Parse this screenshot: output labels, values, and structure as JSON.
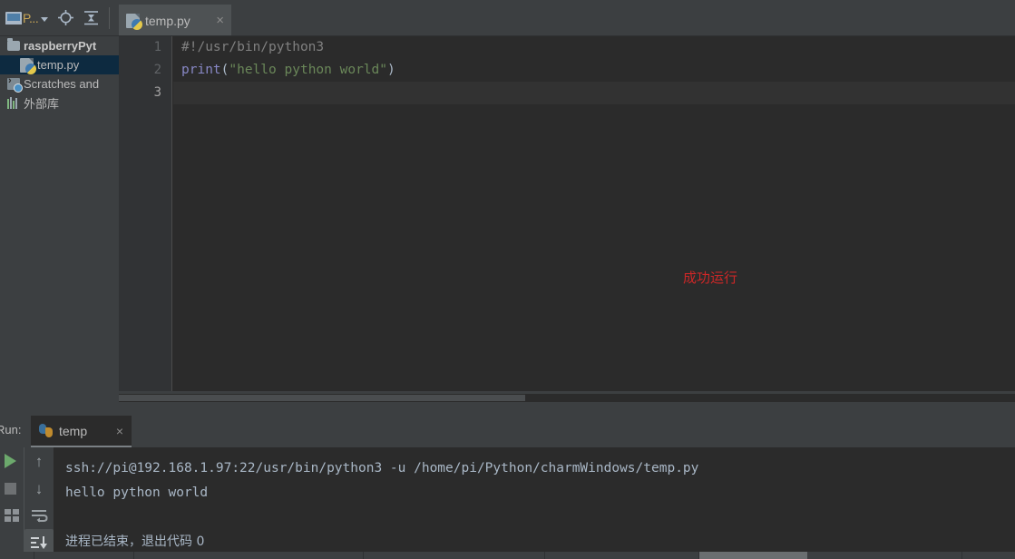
{
  "toolbar": {
    "project_button_label": "P...",
    "project_icon": "project-window-icon",
    "locate_icon": "target-locate-icon",
    "collapse_icon": "collapse-all-icon"
  },
  "editor_tabs": [
    {
      "label": "temp.py",
      "icon": "python-file-icon",
      "close": "×",
      "active": true
    }
  ],
  "project_tree": {
    "items": [
      {
        "label": "raspberryPyt",
        "icon": "folder-icon",
        "bold": true,
        "selected": false,
        "indent": false
      },
      {
        "label": "temp.py",
        "icon": "python-file-icon",
        "bold": false,
        "selected": true,
        "indent": true
      },
      {
        "label": "Scratches and",
        "icon": "scratches-icon",
        "bold": false,
        "selected": false,
        "indent": false
      },
      {
        "label": "外部库",
        "icon": "external-libraries-icon",
        "bold": false,
        "selected": false,
        "indent": false
      }
    ]
  },
  "editor": {
    "line_numbers": [
      "1",
      "2",
      "3"
    ],
    "current_line": 3,
    "lines": [
      {
        "tokens": [
          {
            "text": "#!/usr/bin/python3",
            "type": "comment"
          }
        ]
      },
      {
        "tokens": [
          {
            "text": "print",
            "type": "fn"
          },
          {
            "text": "(",
            "type": "punct"
          },
          {
            "text": "\"hello python world\"",
            "type": "str"
          },
          {
            "text": ")",
            "type": "punct"
          }
        ]
      },
      {
        "tokens": [
          {
            "text": "",
            "type": "punct"
          }
        ]
      }
    ],
    "annotation": {
      "text": "成功运行",
      "color": "#cc2727"
    }
  },
  "run_panel": {
    "label": "Run:",
    "tabs": [
      {
        "label": "temp",
        "icon": "python-logo-icon",
        "close": "×",
        "active": true
      }
    ],
    "side_buttons": [
      {
        "name": "rerun-button",
        "icon": "run-triangle-icon"
      },
      {
        "name": "stop-button",
        "icon": "stop-square-icon"
      },
      {
        "name": "print-button",
        "icon": "print-icon"
      }
    ],
    "side_buttons_2": [
      {
        "name": "up-stack-button",
        "icon": "arrow-up-icon",
        "glyph": "↑"
      },
      {
        "name": "down-stack-button",
        "icon": "arrow-down-icon",
        "glyph": "↓"
      },
      {
        "name": "soft-wrap-button",
        "icon": "soft-wrap-icon",
        "glyph": "↩"
      },
      {
        "name": "scroll-to-end-button",
        "icon": "scroll-to-end-icon",
        "glyph": "⤓"
      }
    ],
    "console_lines": [
      {
        "text": "ssh://pi@192.168.1.97:22/usr/bin/python3 -u /home/pi/Python/charmWindows/temp.py",
        "cjk": false
      },
      {
        "text": "hello python world",
        "cjk": false
      },
      {
        "text": "",
        "cjk": false
      },
      {
        "text": "进程已结束，退出代码 0",
        "cjk": true
      }
    ]
  },
  "colors": {
    "panel_bg": "#3c3f41",
    "editor_bg": "#2b2b2b",
    "gutter_bg": "#313335",
    "selection_blue": "#0d2a40",
    "text": "#a9b7c6",
    "comment": "#808080",
    "string": "#6a8759",
    "keyword_fn": "#8888c6",
    "annotation_red": "#cc2727"
  }
}
